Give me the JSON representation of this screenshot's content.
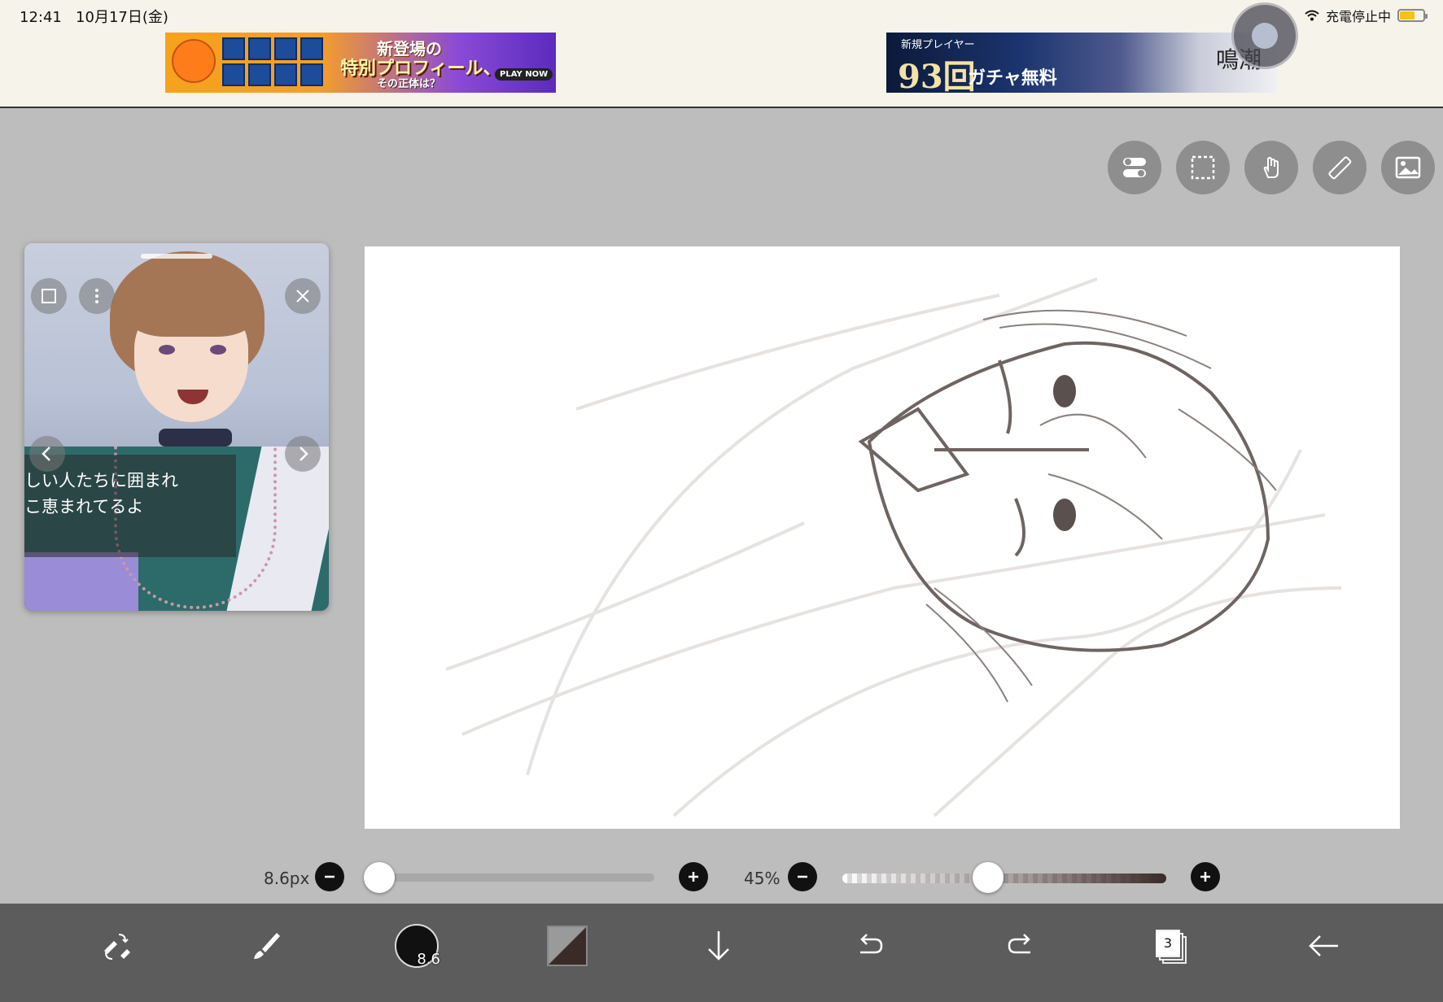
{
  "status_bar": {
    "time": "12:41",
    "date": "10月17日(金)",
    "charging": "充電停止中"
  },
  "ads": {
    "left": {
      "line1": "新登場の",
      "line2": "特別プロフィール、",
      "line3": "その正体は？",
      "cta": "PLAY NOW"
    },
    "right": {
      "sub": "新規プレイヤー",
      "number": "93回",
      "gacha": "ガチャ無料",
      "logo": "鳴潮"
    }
  },
  "toolbar_top": {
    "icons": [
      "toggle-icon",
      "selection-icon",
      "hand-touch-icon",
      "ruler-icon",
      "image-icon"
    ]
  },
  "reference_window": {
    "caption_line1": "しい人たちに囲まれ",
    "caption_line2": "こ恵まれてるよ"
  },
  "brush": {
    "size_label": "8.6px",
    "size_value": 8.6,
    "size_fraction": 0.04,
    "opacity_label": "45%",
    "opacity_fraction": 0.45,
    "brush_badge": "8.6"
  },
  "bottom_bar": {
    "layer_count": "3"
  },
  "colors": {
    "brush_color": "#111111",
    "secondary_color": "#3a2a28",
    "toolbar_bg": "#5c5c5c",
    "workspace_bg": "#bdbdbd"
  }
}
